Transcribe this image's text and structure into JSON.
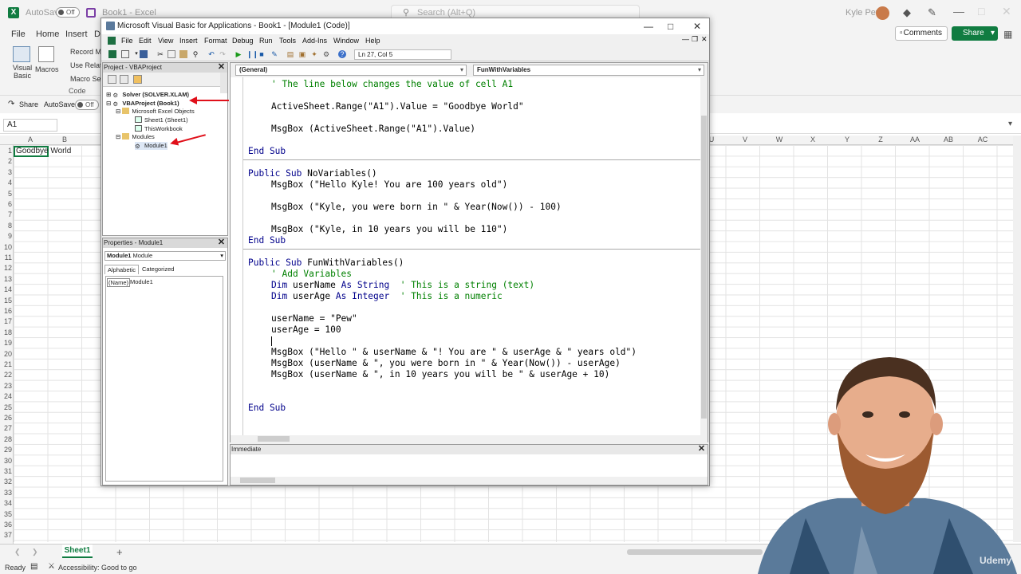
{
  "excel": {
    "autosave_label": "AutoSave",
    "autosave_state": "Off",
    "doc_title": "Book1 - Excel",
    "search_placeholder": "Search (Alt+Q)",
    "user_name": "Kyle Pew",
    "menu": [
      "File",
      "Home",
      "Insert",
      "Dr"
    ],
    "comments_label": "Comments",
    "share_label": "Share",
    "ribbon": {
      "visual_basic": "Visual Basic",
      "macros": "Macros",
      "record_macro": "Record Ma",
      "use_relative": "Use Relati",
      "macro_security": "Macro Sec",
      "code_group": "Code"
    },
    "share_row_share": "Share",
    "share_row_autosave": "AutoSave",
    "share_row_state": "Off",
    "name_box": "A1",
    "columns_left": [
      "A",
      "B"
    ],
    "columns_right": [
      "U",
      "V",
      "W",
      "X",
      "Y",
      "Z",
      "AA",
      "AB",
      "AC"
    ],
    "rows": [
      "1",
      "2",
      "3",
      "4",
      "5",
      "6",
      "7",
      "8",
      "9",
      "10",
      "11",
      "12",
      "13",
      "14",
      "15",
      "16",
      "17",
      "18",
      "19",
      "20",
      "21",
      "22",
      "23",
      "24",
      "25",
      "26",
      "27",
      "28",
      "29",
      "30",
      "31",
      "32",
      "33",
      "34",
      "35",
      "36",
      "37"
    ],
    "cell_a1": "Goodbye World",
    "sheet_tab": "Sheet1",
    "add_sheet": "+",
    "status_ready": "Ready",
    "status_accessibility": "Accessibility: Good to go"
  },
  "vbe": {
    "title": "Microsoft Visual Basic for Applications - Book1 - [Module1 (Code)]",
    "menu": [
      "File",
      "Edit",
      "View",
      "Insert",
      "Format",
      "Debug",
      "Run",
      "Tools",
      "Add-Ins",
      "Window",
      "Help"
    ],
    "position": "Ln 27, Col 5",
    "project_pane_title": "Project - VBAProject",
    "tree": {
      "solver": "Solver (SOLVER.XLAM)",
      "vbaproject": "VBAProject (Book1)",
      "excel_objects": "Microsoft Excel Objects",
      "sheet1": "Sheet1 (Sheet1)",
      "thisworkbook": "ThisWorkbook",
      "modules": "Modules",
      "module1": "Module1"
    },
    "properties_title": "Properties - Module1",
    "properties_object": "Module1",
    "properties_type": "Module",
    "tab_alphabetic": "Alphabetic",
    "tab_categorized": "Categorized",
    "prop_name_key": "(Name)",
    "prop_name_value": "Module1",
    "combo_general": "(General)",
    "combo_proc": "FunWithVariables",
    "immediate_title": "Immediate",
    "code": {
      "l1": "' The line below changes the value of cell A1",
      "l2": "ActiveSheet.Range(\"A1\").Value = \"Goodbye World\"",
      "l3": "MsgBox (ActiveSheet.Range(\"A1\").Value)",
      "l4_kw": "End Sub",
      "l5_kw": "Public Sub",
      "l5_name": "NoVariables()",
      "l6": "MsgBox (\"Hello Kyle! You are 100 years old\")",
      "l7": "MsgBox (\"Kyle, you were born in \" & Year(Now()) - 100)",
      "l8": "MsgBox (\"Kyle, in 10 years you will be 110\")",
      "l9_kw": "End Sub",
      "l10_kw": "Public Sub",
      "l10_name": "FunWithVariables()",
      "l11": "' Add Variables",
      "l12_dim": "Dim",
      "l12_var": "userName",
      "l12_as": "As String",
      "l12_cm": "' This is a string (text)",
      "l13_dim": "Dim",
      "l13_var": "userAge",
      "l13_as": "As Integer",
      "l13_cm": "' This is a numeric",
      "l14": "userName = \"Pew\"",
      "l15": "userAge = 100",
      "l16": "MsgBox (\"Hello \" & userName & \"! You are \" & userAge & \" years old\")",
      "l17": "MsgBox (userName & \", you were born in \" & Year(Now()) - userAge)",
      "l18": "MsgBox (userName & \", in 10 years you will be \" & userAge + 10)",
      "l19_kw": "End Sub"
    }
  },
  "watermark": "Udemy",
  "colors": {
    "excel_green": "#107c41",
    "vba_keyword": "#00008b",
    "vba_comment": "#008000",
    "annotation_arrow": "#e0101a"
  }
}
